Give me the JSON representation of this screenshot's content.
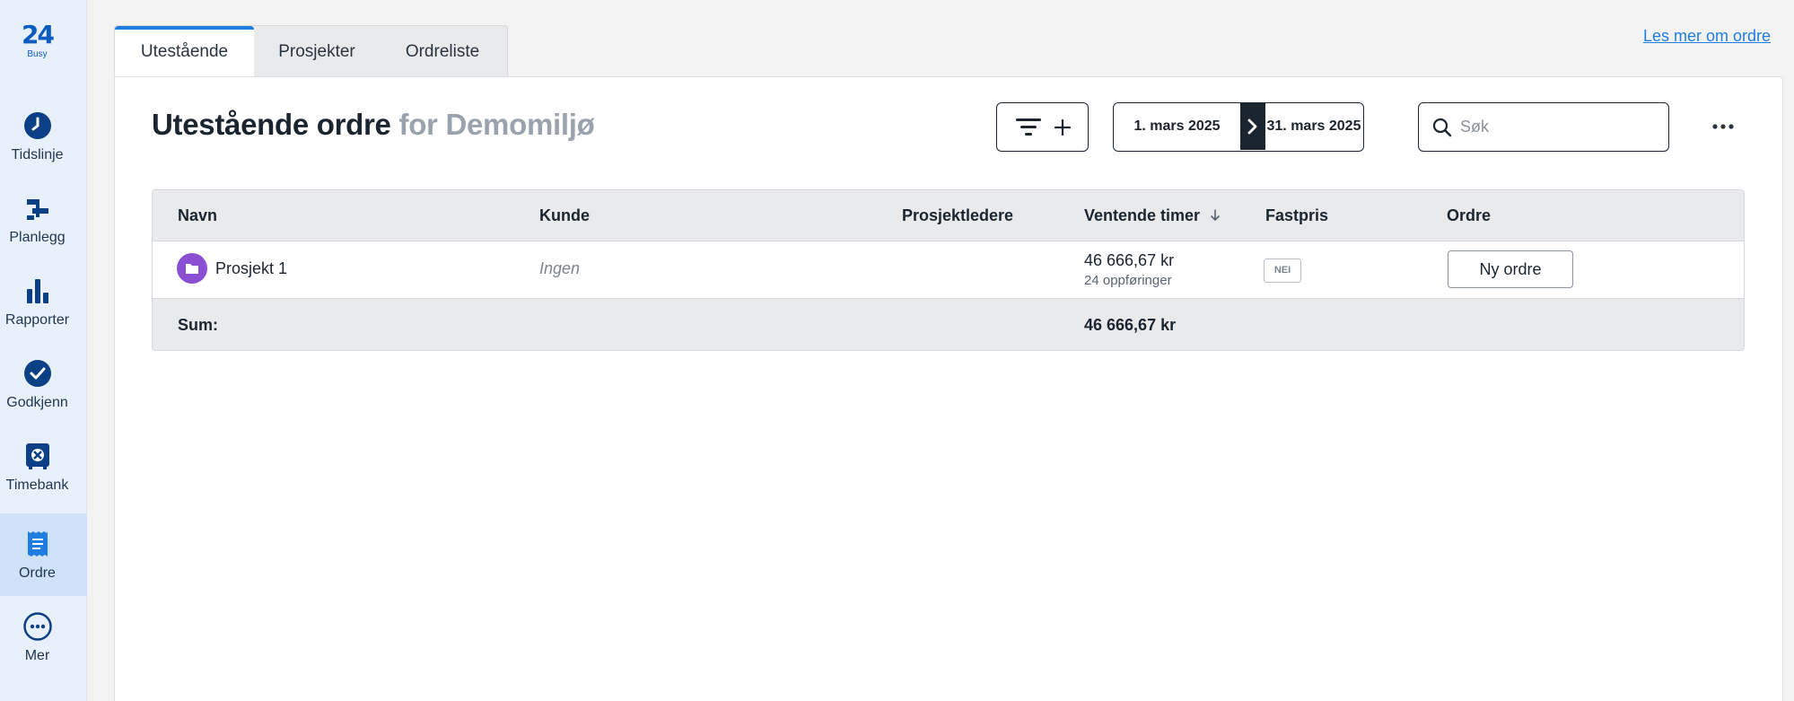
{
  "sidebar": {
    "logo": {
      "mark": "24",
      "sub": "Busy"
    },
    "items": [
      {
        "label": "Tidslinje",
        "icon": "clock-icon"
      },
      {
        "label": "Planlegg",
        "icon": "gantt-icon"
      },
      {
        "label": "Rapporter",
        "icon": "bar-chart-icon"
      },
      {
        "label": "Godkjenn",
        "icon": "check-circle-icon"
      },
      {
        "label": "Timebank",
        "icon": "safe-icon"
      },
      {
        "label": "Ordre",
        "icon": "receipt-icon",
        "active": true
      },
      {
        "label": "Mer",
        "icon": "more-circle-icon"
      }
    ]
  },
  "tabs": [
    {
      "label": "Utestående",
      "active": true
    },
    {
      "label": "Prosjekter"
    },
    {
      "label": "Ordreliste"
    }
  ],
  "header": {
    "learn_more": "Les mer om ordre",
    "title": "Utestående ordre",
    "title_for": "for Demomiljø",
    "date_from": "1. mars 2025",
    "date_to": "31. mars 2025",
    "search_placeholder": "Søk"
  },
  "table": {
    "columns": [
      "Navn",
      "Kunde",
      "Prosjektledere",
      "Ventende timer",
      "Fastpris",
      "Ordre"
    ],
    "sorted_column": "Ventende timer",
    "rows": [
      {
        "navn": "Prosjekt 1",
        "kunde": "Ingen",
        "prosjektledere": "",
        "ventende_timer": "46 666,67 kr",
        "oppforinger": "24 oppføringer",
        "fastpris": "NEI",
        "ordre_button": "Ny ordre"
      }
    ],
    "sum_label": "Sum:",
    "sum_value": "46 666,67 kr"
  },
  "colors": {
    "accent": "#1f7de1",
    "brand": "#0b5cc1",
    "project_folder": "#8a4fd3",
    "sidebar_bg": "#e8f1fb",
    "sidebar_active": "#cfe3f8"
  }
}
